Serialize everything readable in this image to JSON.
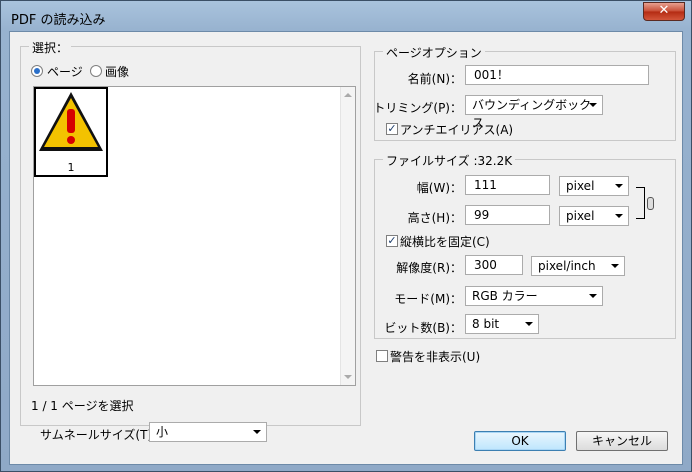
{
  "window": {
    "title": "PDF の読み込み",
    "close_label": "✕"
  },
  "selection": {
    "group_title": "選択：",
    "radio_page": "ページ",
    "radio_image": "画像",
    "selected": "ページ",
    "thumbnails": [
      {
        "page_number": "1"
      }
    ],
    "status_text": "1 / 1 ページを選択",
    "thumb_size_label": "サムネールサイズ(T)：",
    "thumb_size_value": "小"
  },
  "page_options": {
    "group_title": "ページオプション",
    "name_label": "名前(N)：",
    "name_value": "001！",
    "crop_label": "トリミング(P)：",
    "crop_value": "バウンディングボックス",
    "antialias_label": "アンチエイリアス(A)",
    "antialias_checked": true
  },
  "image_size": {
    "group_title": "ファイルサイズ :32.2K",
    "width_label": "幅(W)：",
    "width_value": "111",
    "width_unit": "pixel",
    "height_label": "高さ(H)：",
    "height_value": "99",
    "height_unit": "pixel",
    "constrain_label": "縦横比を固定(C)",
    "constrain_checked": true,
    "resolution_label": "解像度(R)：",
    "resolution_value": "300",
    "resolution_unit": "pixel/inch",
    "mode_label": "モード(M)：",
    "mode_value": "RGB カラー",
    "bitdepth_label": "ビット数(B)：",
    "bitdepth_value": "8 bit"
  },
  "suppress_warnings": {
    "label": "警告を非表示(U)",
    "checked": false
  },
  "buttons": {
    "ok": "OK",
    "cancel": "キャンセル"
  },
  "icons": {
    "warning_color": "#f3c200",
    "warning_mark_color": "#d60000",
    "check_glyph": "✓"
  }
}
